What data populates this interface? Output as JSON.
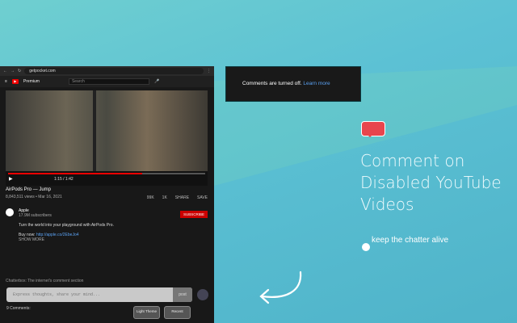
{
  "browser": {
    "url": "getpocket.com",
    "search_placeholder": "Search",
    "logo": "Premium"
  },
  "video": {
    "time": "1:15 / 1:42",
    "progress": 0.68,
    "title": "AirPods Pro — Jump",
    "meta": "8,843,511 views • Mar 16, 2021",
    "actions": [
      "99K",
      "1K",
      "SHARE",
      "SAVE"
    ],
    "channel": "Apple",
    "subscribers": "17.9M subscribers",
    "subscribe": "SUBSCRIBE",
    "description": "Turn the world into your playground with AirPods Pro.",
    "buy_label": "Buy now:",
    "buy_link": "http://apple.co/2EbeJo4",
    "show_more": "SHOW MORE"
  },
  "chatterbox": {
    "label": "Chatterbox: The internet's comment section",
    "placeholder": "Express thoughts, share your mind...",
    "post": "post",
    "count": "9 Comments:",
    "light_theme": "Light Theme",
    "recent": "Recent"
  },
  "popup": {
    "text": "Comments are turned off.",
    "link": "Learn more"
  },
  "promo": {
    "line1": "Comment on",
    "line2": "Disabled YouTube",
    "line3": "Videos",
    "tagline": "keep the chatter alive"
  }
}
